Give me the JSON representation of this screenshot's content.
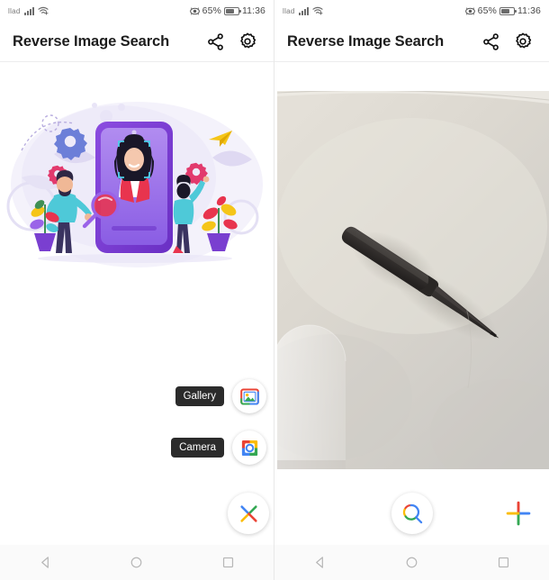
{
  "app": {
    "title": "Reverse Image Search",
    "share_icon": "share-icon",
    "settings_icon": "gear-icon"
  },
  "statusbar": {
    "carrier": "llad",
    "signal_icon": "signal-bars-icon",
    "wifi_icon": "wifi-icon",
    "eye_icon": "eye-comfort-icon",
    "battery_percent": "65%",
    "battery_icon": "battery-icon",
    "time": "11:36"
  },
  "left_screen": {
    "illustration_name": "reverse-image-search-illustration",
    "actions": [
      {
        "label": "Gallery",
        "icon": "gallery-image-icon"
      },
      {
        "label": "Camera",
        "icon": "camera-icon"
      }
    ],
    "fabs": [
      {
        "name": "close-fab",
        "icon": "close-x-icon"
      },
      {
        "name": "edit-fab",
        "icon": "pencil-edit-icon"
      }
    ]
  },
  "right_screen": {
    "photo_name": "selected-photo-knife",
    "photo_description": "black handled knife on light beige surface",
    "fabs": [
      {
        "name": "search-fab",
        "icon": "search-magnifier-icon"
      },
      {
        "name": "add-fab",
        "icon": "plus-add-icon"
      }
    ]
  },
  "navbar": {
    "back": "back-triangle-icon",
    "home": "home-circle-icon",
    "recents": "recents-square-icon"
  },
  "colors": {
    "google_blue": "#4285F4",
    "google_red": "#EA4335",
    "google_yellow": "#FBBC05",
    "google_green": "#34A853",
    "chip_bg": "#2b2b2b",
    "appbar_text": "#1c1c1c"
  }
}
